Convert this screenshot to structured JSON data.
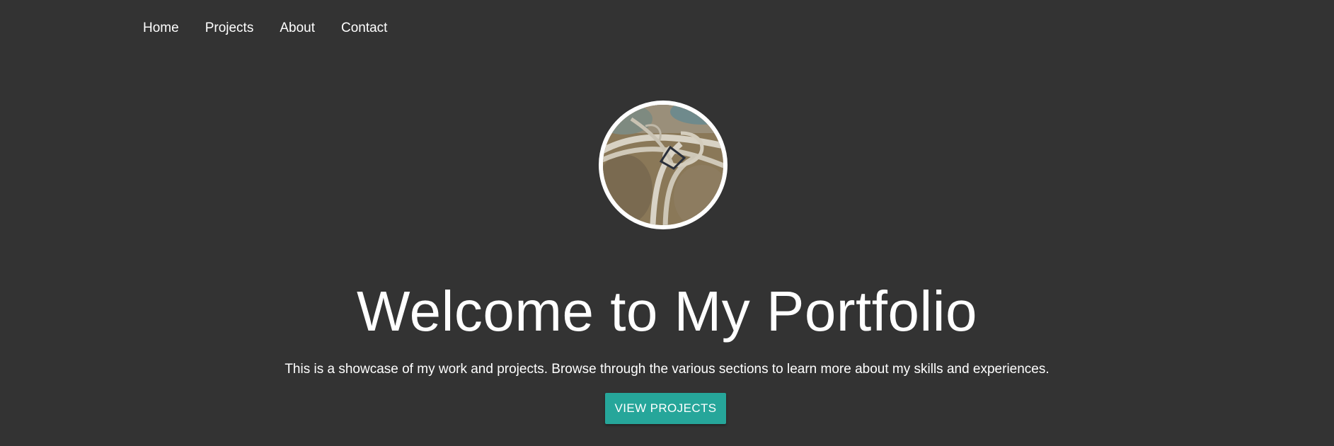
{
  "nav": {
    "items": [
      {
        "label": "Home"
      },
      {
        "label": "Projects"
      },
      {
        "label": "About"
      },
      {
        "label": "Contact"
      }
    ]
  },
  "hero": {
    "avatar_icon": "profile-photo-highway-interchange",
    "title": "Welcome to My Portfolio",
    "subtitle": "This is a showcase of my work and projects. Browse through the various sections to learn more about my skills and experiences.",
    "cta_label": "VIEW PROJECTS"
  },
  "colors": {
    "background": "#333333",
    "text": "#ffffff",
    "accent": "#26a69a"
  }
}
